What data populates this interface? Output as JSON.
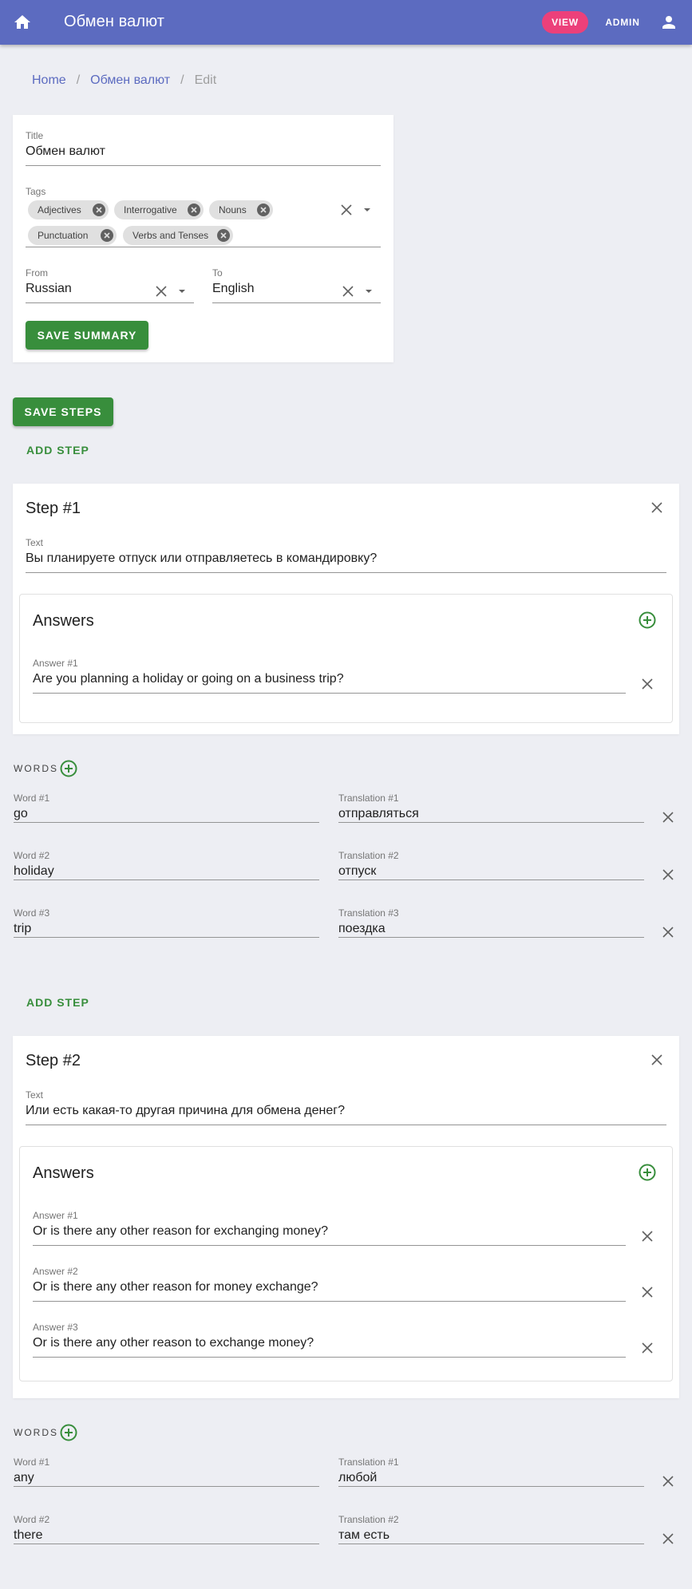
{
  "app": {
    "title": "Обмен валют",
    "view_label": "VIEW",
    "admin_label": "ADMIN",
    "colors": {
      "primary": "#5c6bc0",
      "accent": "#ec407a",
      "success": "#388e3c"
    }
  },
  "breadcrumb": [
    {
      "label": "Home"
    },
    {
      "label": "Обмен валют"
    },
    {
      "label": "Edit"
    }
  ],
  "summary": {
    "title_label": "Title",
    "title_value": "Обмен валют",
    "tags_label": "Tags",
    "tags": [
      "Adjectives",
      "Interrogative",
      "Nouns",
      "Punctuation",
      "Verbs and Tenses"
    ],
    "from_label": "From",
    "from_value": "Russian",
    "to_label": "To",
    "to_value": "English",
    "save_label": "SAVE SUMMARY"
  },
  "actions": {
    "save_steps_label": "SAVE STEPS",
    "add_step_label": "ADD STEP"
  },
  "steps": [
    {
      "title": "Step #1",
      "text_label": "Text",
      "text_value": "Вы планируете отпуск или отправляетесь в командировку?",
      "answers_title": "Answers",
      "answers": [
        {
          "label": "Answer #1",
          "value": "Are you planning a holiday or going on a business trip?"
        }
      ],
      "words_title": "WORDS",
      "words": [
        {
          "word_label": "Word #1",
          "word": "go",
          "translation_label": "Translation #1",
          "translation": "отправляться"
        },
        {
          "word_label": "Word #2",
          "word": "holiday",
          "translation_label": "Translation #2",
          "translation": "отпуск"
        },
        {
          "word_label": "Word #3",
          "word": "trip",
          "translation_label": "Translation #3",
          "translation": "поездка"
        }
      ]
    },
    {
      "title": "Step #2",
      "text_label": "Text",
      "text_value": "Или есть какая-то другая причина для обмена денег?",
      "answers_title": "Answers",
      "answers": [
        {
          "label": "Answer #1",
          "value": "Or is there any other reason for exchanging money?"
        },
        {
          "label": "Answer #2",
          "value": "Or is there any other reason for money exchange?"
        },
        {
          "label": "Answer #3",
          "value": "Or is there any other reason to exchange money?"
        }
      ],
      "words_title": "WORDS",
      "words": [
        {
          "word_label": "Word #1",
          "word": "any",
          "translation_label": "Translation #1",
          "translation": "любой"
        },
        {
          "word_label": "Word #2",
          "word": "there",
          "translation_label": "Translation #2",
          "translation": "там есть"
        }
      ]
    }
  ],
  "icons": [
    "home-icon",
    "account-icon",
    "close-icon",
    "chip-remove-icon",
    "dropdown-arrow-icon",
    "add-circle-icon"
  ]
}
